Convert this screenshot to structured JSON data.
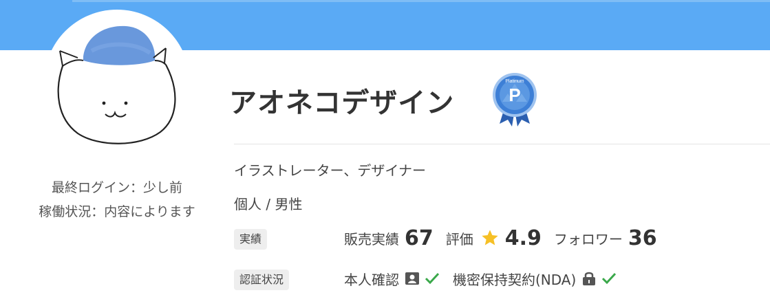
{
  "profile": {
    "name": "アオネコデザイン",
    "rank_badge": "Platinum",
    "rank_letter": "P",
    "last_login": "最終ログイン：少し前",
    "availability": "稼働状況：内容によります",
    "occupation": "イラストレーター、デザイナー",
    "kind": "個人 / 男性"
  },
  "stats": {
    "tag": "実績",
    "sales_label": "販売実績",
    "sales_value": "67",
    "rating_label": "評価",
    "rating_value": "4.9",
    "followers_label": "フォロワー",
    "followers_value": "36"
  },
  "verification": {
    "tag": "認証状況",
    "identity_label": "本人確認",
    "nda_label": "機密保持契約(NDA)"
  },
  "icons": {
    "avatar": "cat-avatar",
    "badge": "platinum-rank-icon",
    "star": "star-icon",
    "identity": "id-card-icon",
    "nda": "lock-icon",
    "check": "check-icon"
  },
  "colors": {
    "banner": "#5aaaf5",
    "star": "#f6c026",
    "check": "#3aa84a",
    "badge": "#3d7fd6"
  }
}
